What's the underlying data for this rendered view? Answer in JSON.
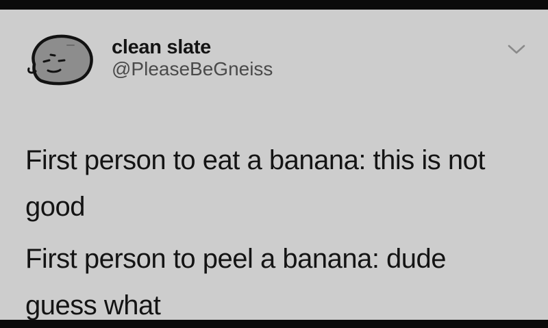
{
  "author": {
    "display_name": "clean slate",
    "handle": "@PleaseBeGneiss",
    "avatar_icon": "grumpy-rock-icon"
  },
  "menu": {
    "icon": "chevron-down-icon"
  },
  "tweet": {
    "lines": [
      "First person to eat a banana: this is not",
      "good",
      "First person to peel a banana: dude",
      "guess what"
    ]
  },
  "colors": {
    "card_background": "#cdcdcd",
    "frame_background": "#0b0b0b",
    "text": "#141414",
    "handle_text": "#4a4a4a"
  }
}
